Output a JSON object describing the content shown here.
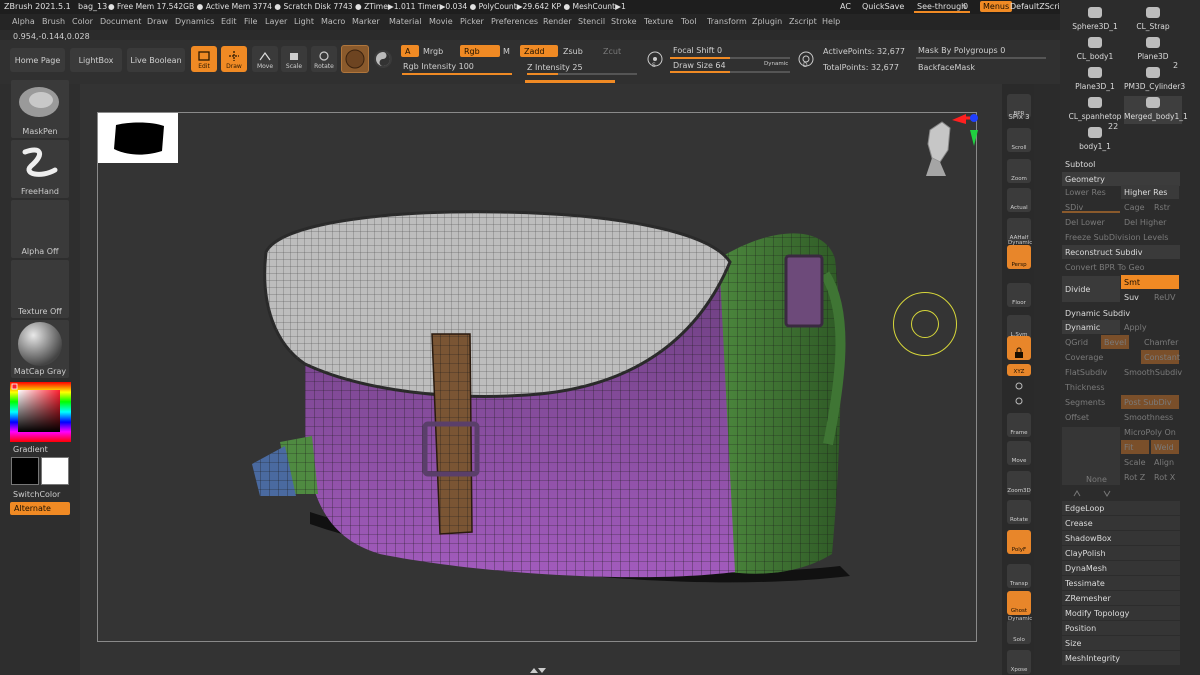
{
  "titlebar": {
    "app": "ZBrush 2021.5.1",
    "doc": "bag_13",
    "stats": "● Free Mem 17.542GB ● Active Mem 3774 ● Scratch Disk 7743 ● ZTime▶1.011 Timer▶0.034 ● PolyCount▶29.642 KP ● MeshCount▶1",
    "ac": "AC",
    "quicksave": "QuickSave",
    "seethrough": "See-through",
    "seethrough_val": "0",
    "menus": "Menus",
    "script": "DefaultZScript"
  },
  "menubar": [
    "Alpha",
    "Brush",
    "Color",
    "Document",
    "Draw",
    "Dynamics",
    "Edit",
    "File",
    "Layer",
    "Light",
    "Macro",
    "Marker",
    "Material",
    "Movie",
    "Picker",
    "Preferences",
    "Render",
    "Stencil",
    "Stroke",
    "Texture",
    "Tool",
    "Transform",
    "Zplugin",
    "Zscript",
    "Help"
  ],
  "coords": "0.954,-0.144,0.028",
  "shelf": {
    "home": "Home Page",
    "lightbox": "LightBox",
    "liveboolean": "Live Boolean",
    "edit": "Edit",
    "draw": "Draw",
    "move": "Move",
    "scale": "Scale",
    "rotate": "Rotate",
    "a": "A",
    "mrgb": "Mrgb",
    "rgb": "Rgb",
    "m": "M",
    "zadd": "Zadd",
    "zsub": "Zsub",
    "zcut": "Zcut",
    "rgb_intensity": "Rgb Intensity 100",
    "z_intensity": "Z Intensity 25",
    "focal_shift": "Focal Shift 0",
    "draw_size": "Draw Size 64",
    "dynamic": "Dynamic",
    "active_points": "ActivePoints: 32,677",
    "total_points": "TotalPoints: 32,677",
    "mask_by_polygroups": "Mask By Polygroups 0",
    "backface_mask": "BackfaceMask"
  },
  "left": {
    "maskpen": "MaskPen",
    "freehand": "FreeHand",
    "alpha_off": "Alpha Off",
    "texture_off": "Texture Off",
    "matcap": "MatCap Gray",
    "gradient": "Gradient",
    "switchcolor": "SwitchColor",
    "alternate": "Alternate"
  },
  "rightstrip": [
    "BPR",
    "SPix 3",
    "Scroll",
    "Zoom",
    "Actual",
    "AAHalf",
    "Persp",
    "Floor",
    "L.Sym",
    "",
    "XYZ",
    "",
    "",
    "Frame",
    "Move",
    "Zoom3D",
    "Rotate",
    "PolyF",
    "Transp",
    "Ghost",
    "Solo",
    "Xpose"
  ],
  "rightstrip_extra": {
    "dynamic_persp": "Dynamic",
    "dynamic_solo": "Dynamic",
    "lock_icon": "lock-icon"
  },
  "tools": {
    "items": [
      "Sphere3D_1",
      "CL_Strap",
      "CL_body1",
      "Plane3D",
      "Plane3D_1",
      "PM3D_Cylinder3",
      "CL_spanhetop",
      "Merged_body1_1",
      "body1_1"
    ],
    "badge1": "2",
    "badge2": "22"
  },
  "subtool": {
    "subtool": "Subtool",
    "geometry": "Geometry",
    "lower_res": "Lower Res",
    "higher_res": "Higher Res",
    "sdiv": "SDiv",
    "cage": "Cage",
    "rstr": "Rstr",
    "del_lower": "Del Lower",
    "del_higher": "Del Higher",
    "freeze": "Freeze SubDivision Levels",
    "reconstruct": "Reconstruct Subdiv",
    "convert_bpr": "Convert BPR To Geo",
    "divide": "Divide",
    "smt": "Smt",
    "suv": "Suv",
    "reuv": "ReUV",
    "dynamic_subdiv": "Dynamic Subdiv",
    "dynamic": "Dynamic",
    "apply": "Apply",
    "qgrid": "QGrid",
    "bevel": "Bevel",
    "chamfer": "Chamfer",
    "coverage": "Coverage",
    "constant": "Constant",
    "flatsubdiv": "FlatSubdiv",
    "smoothsubdiv": "SmoothSubdiv",
    "thickness": "Thickness",
    "segments": "Segments",
    "post_subdiv": "Post SubDiv",
    "offset": "Offset",
    "smoothness": "Smoothness",
    "micropoly": "MicroPoly On",
    "fit": "Fit",
    "weld": "Weld",
    "scale": "Scale",
    "align": "Align",
    "none": "None",
    "rotz": "Rot Z",
    "rotx": "Rot X",
    "sections": [
      "EdgeLoop",
      "Crease",
      "ShadowBox",
      "ClayPolish",
      "DynaMesh",
      "Tessimate",
      "ZRemesher",
      "Modify Topology",
      "Position",
      "Size",
      "MeshIntegrity"
    ]
  }
}
